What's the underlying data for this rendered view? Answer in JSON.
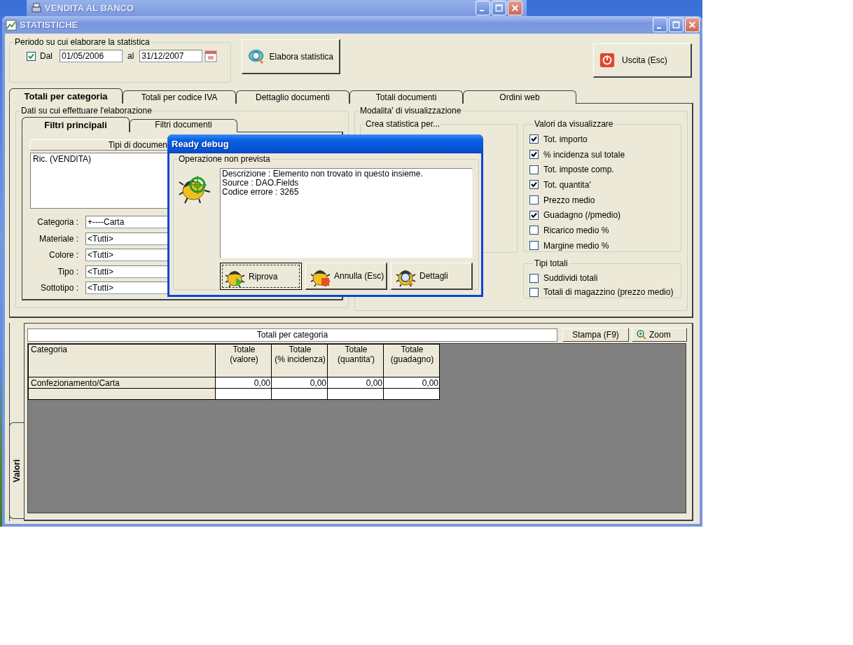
{
  "background_window": {
    "title": "VENDITA AL BANCO"
  },
  "window": {
    "title": "STATISTICHE"
  },
  "period": {
    "legend": "Periodo su cui elaborare la statistica",
    "check_label": "Dal",
    "checked": true,
    "from": "01/05/2006",
    "to_label": "al",
    "to": "31/12/2007"
  },
  "actions": [
    {
      "label": "Elabora statistica",
      "kind": "process"
    },
    {
      "label": "Uscita (Esc)",
      "kind": "exit"
    }
  ],
  "tabs": [
    {
      "label": "Totali per categoria",
      "selected": true
    },
    {
      "label": "Totali per codice IVA",
      "selected": false
    },
    {
      "label": "Dettaglio documenti",
      "selected": false
    },
    {
      "label": "Totali documenti",
      "selected": false
    },
    {
      "label": "Ordini web",
      "selected": false
    }
  ],
  "data_group": {
    "legend": "Dati su cui effettuare l'elaborazione",
    "tabs": [
      {
        "label": "Filtri principali",
        "selected": true
      },
      {
        "label": "Filtri documenti",
        "selected": false
      }
    ],
    "list_header": "Tipi di documen",
    "list_items": [
      "Ric. (VENDITA)"
    ],
    "filters": [
      {
        "label": "Categoria :",
        "value": "+----Carta"
      },
      {
        "label": "Materiale :",
        "value": "<Tutti>"
      },
      {
        "label": "Colore :",
        "value": "<Tutti>"
      },
      {
        "label": "Tipo :",
        "value": "<Tutti>"
      },
      {
        "label": "Sottotipo :",
        "value": "<Tutti>"
      }
    ]
  },
  "display_group": {
    "legend": "Modalita' di visualizzazione",
    "create_legend": "Crea statistica per...",
    "values_legend": "Valori da visualizzare",
    "values": [
      {
        "label": "Tot. importo",
        "checked": true
      },
      {
        "label": "% incidenza sul totale",
        "checked": true
      },
      {
        "label": "Tot. imposte comp.",
        "checked": false
      },
      {
        "label": "Tot. quantita'",
        "checked": true
      },
      {
        "label": "Prezzo medio",
        "checked": false
      },
      {
        "label": "Guadagno (/pmedio)",
        "checked": true
      },
      {
        "label": "Ricarico medio %",
        "checked": false
      },
      {
        "label": "Margine medio %",
        "checked": false
      }
    ],
    "totals_legend": "Tipi totali",
    "totals": [
      {
        "label": "Suddividi totali",
        "checked": false
      },
      {
        "label": "Totali di magazzino (prezzo medio)",
        "checked": false
      }
    ]
  },
  "results": {
    "side_tab": "Valori",
    "title": "Totali per categoria",
    "buttons": [
      {
        "label": "Stampa (F9)",
        "kind": "print"
      },
      {
        "label": "Zoom",
        "kind": "zoom"
      }
    ],
    "columns": [
      "Categoria",
      "Totale\n(valore)",
      "Totale\n(% incidenza)",
      "Totale\n(quantita')",
      "Totale\n(guadagno)"
    ],
    "rows": [
      [
        "Confezionamento/Carta",
        "0,00",
        "0,00",
        "0,00",
        "0,00"
      ]
    ]
  },
  "dialog": {
    "title": "Ready debug",
    "legend": "Operazione non prevista",
    "message_lines": [
      "Descrizione : Elemento non trovato in questo insieme.",
      "Source : DAO.Fields",
      "Codice errore : 3265"
    ],
    "buttons": [
      {
        "label": "Riprova",
        "kind": "retry",
        "focused": true
      },
      {
        "label": "Annulla (Esc)",
        "kind": "cancel",
        "focused": false
      },
      {
        "label": "Dettagli",
        "kind": "details",
        "focused": false
      }
    ]
  }
}
